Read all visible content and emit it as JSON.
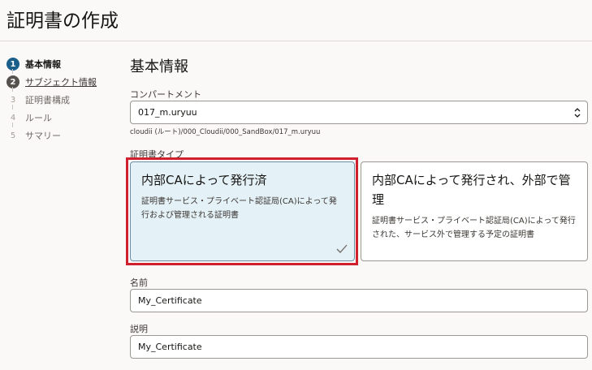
{
  "header": {
    "title": "証明書の作成"
  },
  "steps": [
    {
      "num": "1",
      "label": "基本情報"
    },
    {
      "num": "2",
      "label": "サブジェクト情報"
    },
    {
      "num": "3",
      "label": "証明書構成"
    },
    {
      "num": "4",
      "label": "ルール"
    },
    {
      "num": "5",
      "label": "サマリー"
    }
  ],
  "form": {
    "section_title": "基本情報",
    "compartment": {
      "label": "コンパートメント",
      "value": "017_m.uryuu",
      "path": "cloudii (ルート)/000_Cloudii/000_SandBox/017_m.uryuu"
    },
    "cert_type": {
      "label": "証明書タイプ",
      "options": [
        {
          "title": "内部CAによって発行済",
          "desc": "証明書サービス・プライベート認証局(CA)によって発行および管理される証明書"
        },
        {
          "title": "内部CAによって発行され、外部で管理",
          "desc": "証明書サービス・プライベート認証局(CA)によって発行された、サービス外で管理する予定の証明書"
        }
      ]
    },
    "name": {
      "label": "名前",
      "value": "My_Certificate"
    },
    "description": {
      "label": "説明",
      "value": "My_Certificate"
    }
  },
  "colors": {
    "accent": "#1a5e8a",
    "highlight": "#d1202d",
    "selected_bg": "#e4f1f7"
  }
}
